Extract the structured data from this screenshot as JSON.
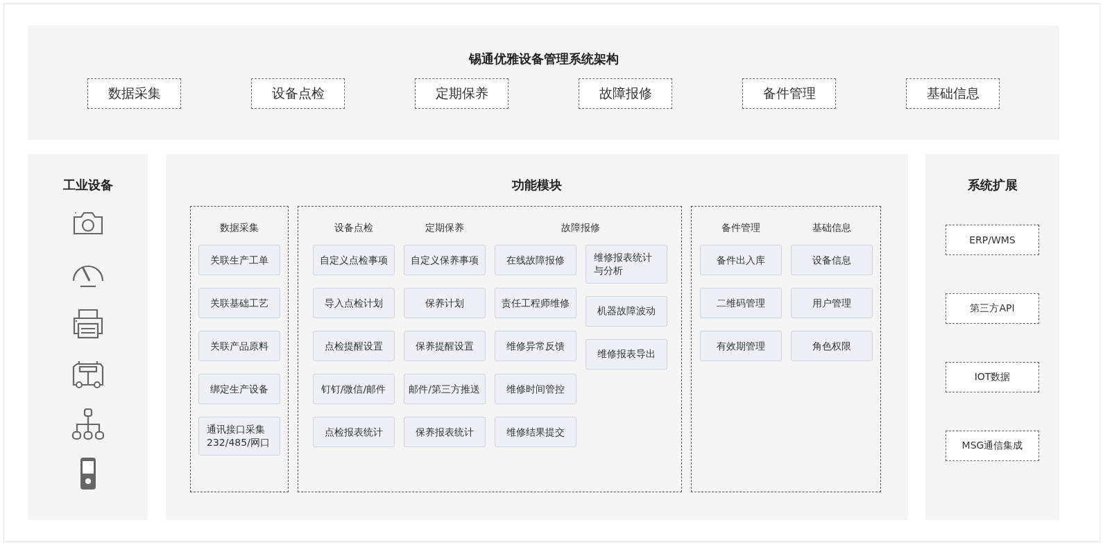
{
  "title": "锡通优雅设备管理系统架构",
  "top_modules": [
    "数据采集",
    "设备点检",
    "定期保养",
    "故障报修",
    "备件管理",
    "基础信息"
  ],
  "devices": {
    "title": "工业设备"
  },
  "functions": {
    "title": "功能模块",
    "groups": [
      {
        "columns": [
          {
            "heading": "数据采集",
            "lists": [
              [
                "关联生产工单",
                "关联基础工艺",
                "关联产品原料",
                "绑定生产设备",
                "通讯接口采集 232/485/网口"
              ]
            ]
          }
        ]
      },
      {
        "columns": [
          {
            "heading": "设备点检",
            "lists": [
              [
                "自定义点检事项",
                "导入点检计划",
                "点检提醒设置",
                "钉钉/微信/邮件",
                "点检报表统计"
              ]
            ]
          },
          {
            "heading": "定期保养",
            "lists": [
              [
                "自定义保养事项",
                "保养计划",
                "保养提醒设置",
                "邮件/第三方推送",
                "保养报表统计"
              ]
            ]
          },
          {
            "heading": "故障报修",
            "lists": [
              [
                "在线故障报修",
                "责任工程师维修",
                "维修异常反馈",
                "维修时间管控",
                "维修结果提交"
              ],
              [
                "维修报表统计与分析",
                "机器故障波动",
                "维修报表导出"
              ]
            ]
          }
        ]
      },
      {
        "columns": [
          {
            "heading": "备件管理",
            "lists": [
              [
                "备件出入库",
                "二维码管理",
                "有效期管理"
              ]
            ]
          },
          {
            "heading": "基础信息",
            "lists": [
              [
                "设备信息",
                "用户管理",
                "角色权限"
              ]
            ]
          }
        ]
      }
    ]
  },
  "extensions": {
    "title": "系统扩展",
    "items": [
      "ERP/WMS",
      "第三方API",
      "IOT数据",
      "MSG通信集成"
    ]
  }
}
